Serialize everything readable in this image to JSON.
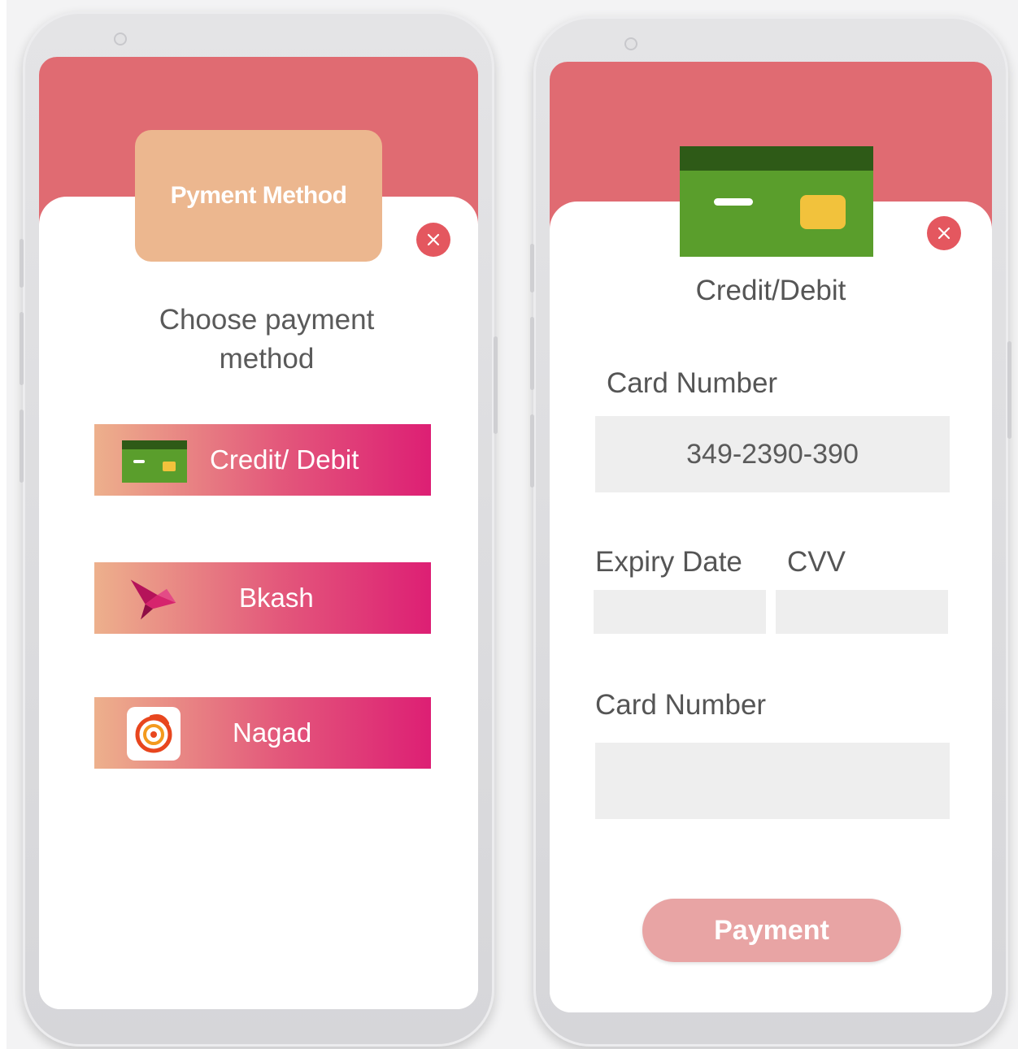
{
  "left_screen": {
    "badge_title": "Pyment Method",
    "prompt": "Choose payment method",
    "options": [
      {
        "label": "Credit/ Debit",
        "icon": "credit-card-icon"
      },
      {
        "label": "Bkash",
        "icon": "bkash-bird-icon"
      },
      {
        "label": "Nagad",
        "icon": "nagad-logo-icon"
      }
    ],
    "close_icon": "close-icon"
  },
  "right_screen": {
    "title": "Credit/Debit",
    "card_number_label": "Card Number",
    "card_number_value": "349-2390-390",
    "expiry_label": "Expiry Date",
    "cvv_label": "CVV",
    "expiry_value": "",
    "cvv_value": "",
    "second_card_number_label": "Card Number",
    "second_card_number_value": "",
    "payment_button": "Payment",
    "close_icon": "close-icon"
  },
  "colors": {
    "header": "#e06b72",
    "badge": "#ecb78f",
    "option_gradient_start": "#edb08c",
    "option_gradient_end": "#dd1f74",
    "close_button": "#e4575f",
    "payment_button": "#e8a4a4",
    "card_green": "#5a9e2c",
    "card_dark_green": "#2e5a17",
    "card_chip": "#f2c23c"
  }
}
